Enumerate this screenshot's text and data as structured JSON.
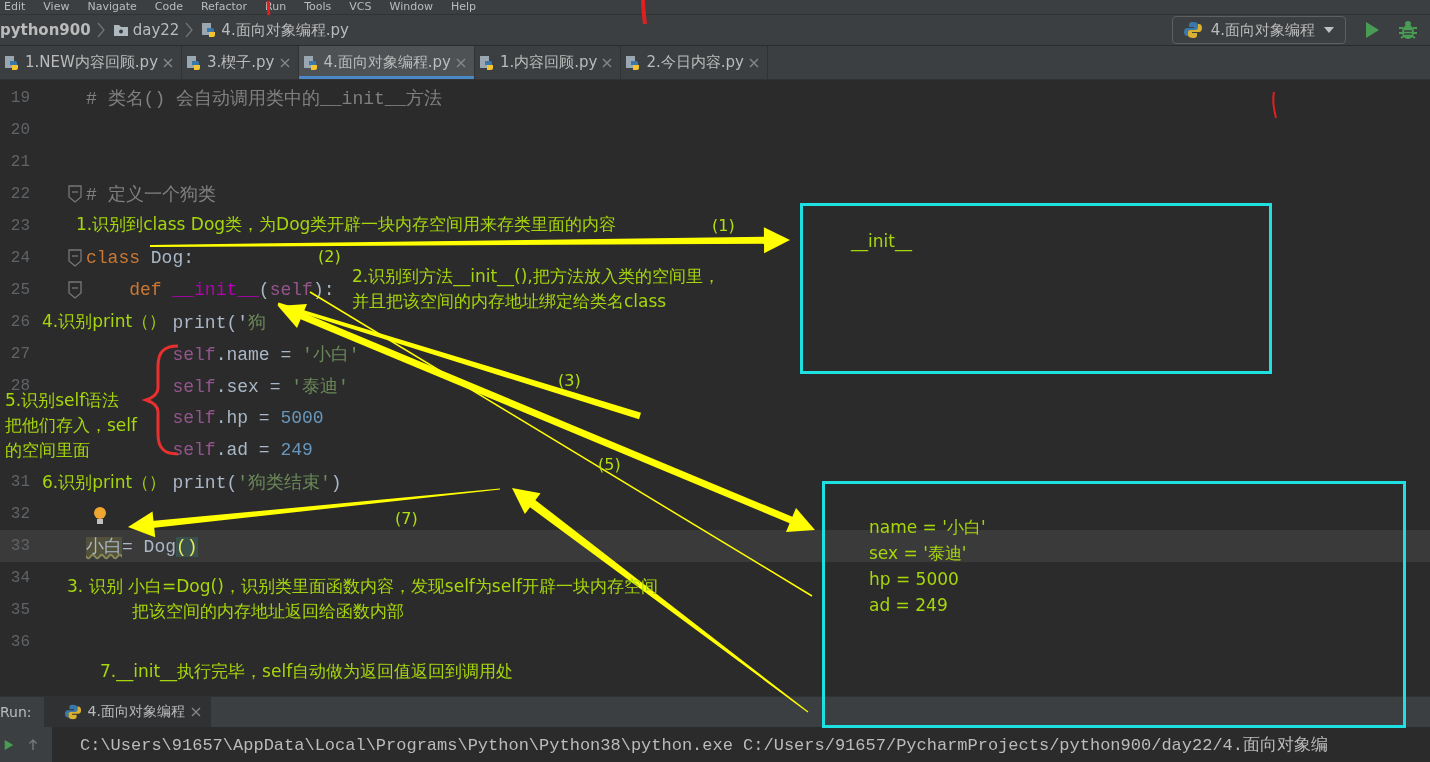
{
  "menu_bar": [
    "Edit",
    "View",
    "Navigate",
    "Code",
    "Refactor",
    "Run",
    "Tools",
    "VCS",
    "Window",
    "Help"
  ],
  "breadcrumb": [
    {
      "kind": "project",
      "label": "python900"
    },
    {
      "kind": "folder",
      "label": "day22"
    },
    {
      "kind": "file",
      "label": "4.面向对象编程.py"
    }
  ],
  "run_config": {
    "label": "4.面向对象编程"
  },
  "tabs": [
    {
      "label": "1.NEW内容回顾.py",
      "selected": false
    },
    {
      "label": "3.楔子.py",
      "selected": false
    },
    {
      "label": "4.面向对象编程.py",
      "selected": true
    },
    {
      "label": "1.内容回顾.py",
      "selected": false
    },
    {
      "label": "2.今日内容.py",
      "selected": false
    }
  ],
  "editor": {
    "lines": [
      {
        "number": "19",
        "current": false,
        "fold": false,
        "tokens": [
          {
            "kind": "comment",
            "text": "# 类名() 会自动调用类中的__init__方法"
          }
        ]
      },
      {
        "number": "20",
        "current": false,
        "fold": false
      },
      {
        "number": "21",
        "current": false,
        "fold": false
      },
      {
        "number": "22",
        "current": false,
        "fold": true,
        "tokens": [
          {
            "kind": "comment",
            "text": "# 定义一个狗类"
          }
        ]
      },
      {
        "number": "23",
        "current": false,
        "fold": false
      },
      {
        "number": "24",
        "current": false,
        "fold": true,
        "tokens": [
          {
            "kind": "keyword",
            "text": "class "
          },
          {
            "kind": "plain",
            "text": "Dog:"
          }
        ]
      },
      {
        "number": "25",
        "current": false,
        "fold": true,
        "tokens": [
          {
            "kind": "keyword",
            "text": "    def "
          },
          {
            "kind": "magic",
            "text": "__init__"
          },
          {
            "kind": "plain",
            "text": "("
          },
          {
            "kind": "self",
            "text": "self"
          },
          {
            "kind": "plain",
            "text": "):"
          }
        ]
      },
      {
        "number": "26",
        "current": false,
        "fold": false,
        "tokens": [
          {
            "kind": "plain",
            "text": "        print('"
          },
          {
            "kind": "string",
            "text": "狗"
          }
        ]
      },
      {
        "number": "27",
        "current": false,
        "fold": false,
        "tokens": [
          {
            "kind": "self",
            "text": "        self"
          },
          {
            "kind": "plain",
            "text": ".name = "
          },
          {
            "kind": "string",
            "text": "'小白'"
          }
        ]
      },
      {
        "number": "28",
        "current": false,
        "fold": false,
        "tokens": [
          {
            "kind": "self",
            "text": "        self"
          },
          {
            "kind": "plain",
            "text": ".sex = "
          },
          {
            "kind": "string",
            "text": "'泰迪'"
          }
        ]
      },
      {
        "current": false,
        "fold": false,
        "tokens": [
          {
            "kind": "self",
            "text": "        self"
          },
          {
            "kind": "plain",
            "text": ".hp = "
          },
          {
            "kind": "number",
            "text": "5000"
          }
        ]
      },
      {
        "current": false,
        "fold": false,
        "tokens": [
          {
            "kind": "self",
            "text": "        self"
          },
          {
            "kind": "plain",
            "text": ".ad = "
          },
          {
            "kind": "number",
            "text": "249"
          }
        ]
      },
      {
        "number": "31",
        "current": false,
        "fold": false,
        "tokens": [
          {
            "kind": "plain",
            "text": "        print("
          },
          {
            "kind": "string",
            "text": "'狗类结束'"
          },
          {
            "kind": "plain",
            "text": ")"
          }
        ]
      },
      {
        "number": "32",
        "current": false,
        "fold": false
      },
      {
        "number": "33",
        "current": true,
        "fold": false,
        "tokens": [
          {
            "kind": "warn",
            "text": "小白"
          },
          {
            "kind": "plain",
            "text": "= Dog"
          },
          {
            "kind": "paren",
            "text": "()"
          }
        ]
      },
      {
        "number": "34",
        "current": false,
        "fold": false
      },
      {
        "number": "35",
        "current": false,
        "fold": false
      },
      {
        "number": "36",
        "current": false,
        "fold": false
      }
    ]
  },
  "annotations": [
    {
      "kind": "note",
      "lines": [
        "1.识别到class Dog类，为Dog类开辟一块内存空间用来存类里面的内容"
      ]
    },
    {
      "kind": "step",
      "lines": [
        "(1)"
      ]
    },
    {
      "kind": "step",
      "lines": [
        "(2)"
      ]
    },
    {
      "kind": "note",
      "lines": [
        "2.识别到方法__init__(),把方法放入类的空间里，",
        "并且把该空间的内存地址绑定给类名class"
      ]
    },
    {
      "kind": "note",
      "lines": [
        "4.识别print（）"
      ]
    },
    {
      "kind": "note",
      "lines": [
        "5.识别self语法",
        "把他们存入，self",
        "的空间里面"
      ]
    },
    {
      "kind": "step",
      "lines": [
        "(3)"
      ]
    },
    {
      "kind": "step",
      "lines": [
        "(5)"
      ]
    },
    {
      "kind": "note",
      "lines": [
        "6.识别print（）"
      ]
    },
    {
      "kind": "step",
      "lines": [
        "(7)"
      ]
    },
    {
      "kind": "note",
      "lines": [
        "3. 识别 小白=Dog()，识别类里面函数内容，发现self为self开辟一块内存空间",
        "把该空间的内存地址返回给函数内部"
      ]
    },
    {
      "kind": "note",
      "lines": [
        "7.__init__执行完毕，self自动做为返回值返回到调用处"
      ]
    }
  ],
  "memory_boxes": [
    {
      "lines": [
        "__init__"
      ]
    },
    {
      "lines": [
        "name = '小白'",
        "sex = '泰迪'",
        "hp = 5000",
        "ad = 249"
      ]
    }
  ],
  "run_panel": {
    "label": "Run:",
    "tab": "4.面向对象编程",
    "command": "C:\\Users\\91657\\AppData\\Local\\Programs\\Python\\Python38\\python.exe C:/Users/91657/PycharmProjects/python900/day22/4.面向对象编"
  }
}
